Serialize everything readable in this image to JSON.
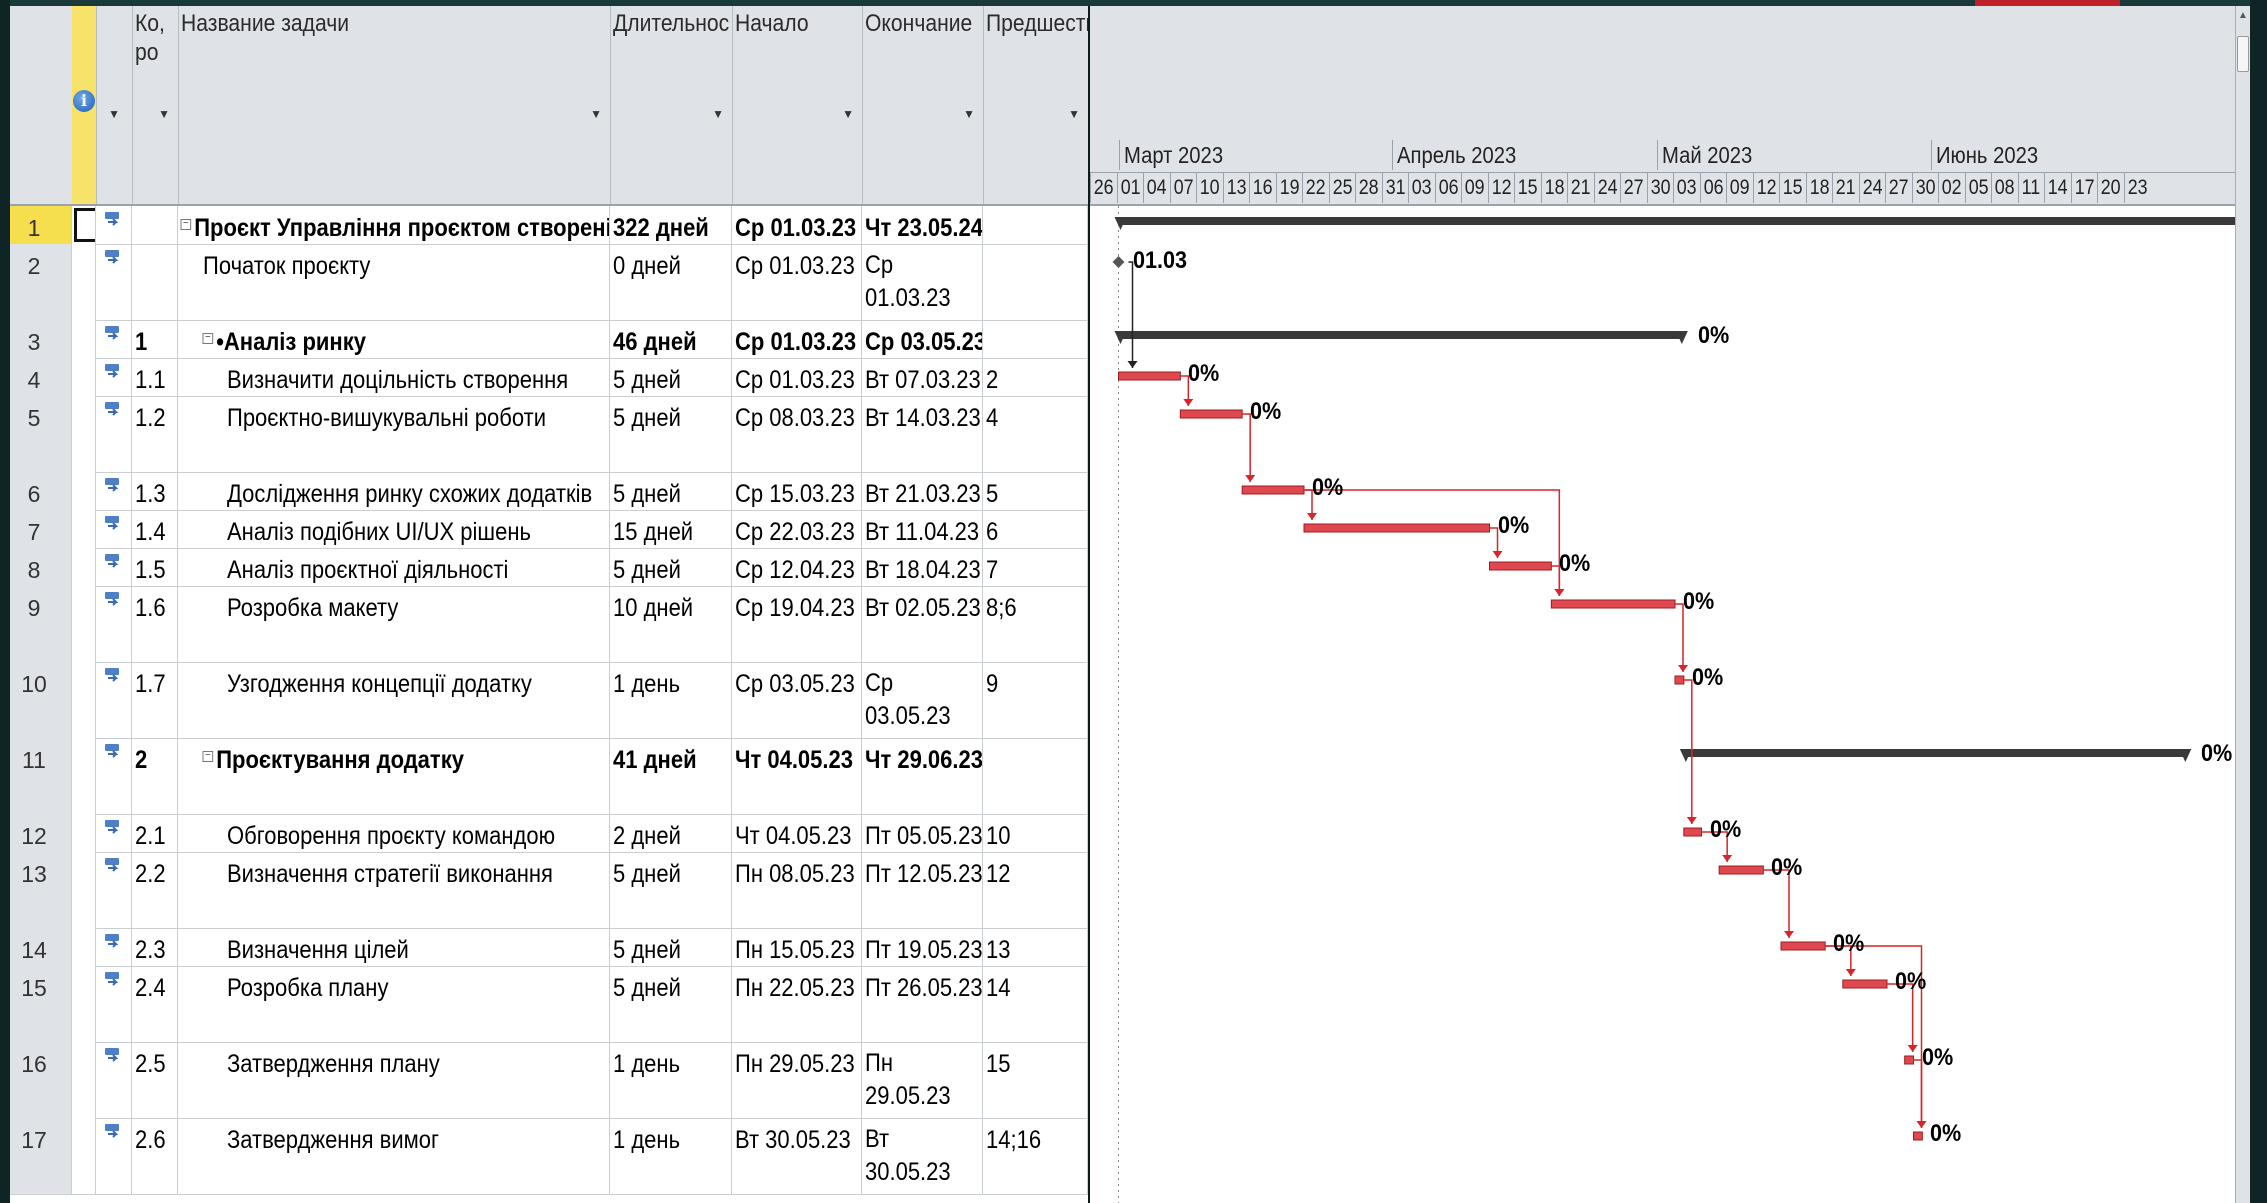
{
  "columns": {
    "info": "",
    "code": "Ко, ро",
    "name": "Название задачи",
    "duration": "Длительнос",
    "start": "Начало",
    "finish": "Окончание",
    "predecessors": "Предшеств"
  },
  "timescale": {
    "months": [
      "Март 2023",
      "Апрель 2023",
      "Май 2023",
      "Июнь 2023"
    ],
    "days": [
      "26",
      "01",
      "04",
      "07",
      "10",
      "13",
      "16",
      "19",
      "22",
      "25",
      "28",
      "31",
      "03",
      "06",
      "09",
      "12",
      "15",
      "18",
      "21",
      "24",
      "27",
      "30",
      "03",
      "06",
      "09",
      "12",
      "15",
      "18",
      "21",
      "24",
      "27",
      "30",
      "02",
      "05",
      "08",
      "11",
      "14",
      "17",
      "20",
      "23"
    ]
  },
  "tasks": [
    {
      "id": "1",
      "code": "",
      "name": "Проєкт Управління проєктом створені",
      "duration": "322 дней",
      "start": "Ср 01.03.23",
      "finish": "Чт 23.05.24",
      "pred": "",
      "bold": true,
      "indent": 0,
      "collapse": true
    },
    {
      "id": "2",
      "code": "",
      "name": "Початок проєкту",
      "duration": "0 дней",
      "start": "Ср 01.03.23",
      "finish": "Ср 01.03.23",
      "pred": "",
      "bold": false,
      "indent": 1,
      "collapse": false
    },
    {
      "id": "3",
      "code": "1",
      "name": "•Аналіз ринку",
      "duration": "46 дней",
      "start": "Ср 01.03.23",
      "finish": "Ср 03.05.23",
      "pred": "",
      "bold": true,
      "indent": 1,
      "collapse": true
    },
    {
      "id": "4",
      "code": "1.1",
      "name": "Визначити доцільність створення",
      "duration": "5 дней",
      "start": "Ср 01.03.23",
      "finish": "Вт 07.03.23",
      "pred": "2",
      "bold": false,
      "indent": 2,
      "collapse": false
    },
    {
      "id": "5",
      "code": "1.2",
      "name": "Проєктно-вишукувальні роботи",
      "duration": "5 дней",
      "start": "Ср 08.03.23",
      "finish": "Вт 14.03.23",
      "pred": "4",
      "bold": false,
      "indent": 2,
      "collapse": false
    },
    {
      "id": "6",
      "code": "1.3",
      "name": "Дослідження ринку схожих додатків",
      "duration": "5 дней",
      "start": "Ср 15.03.23",
      "finish": "Вт 21.03.23",
      "pred": "5",
      "bold": false,
      "indent": 2,
      "collapse": false
    },
    {
      "id": "7",
      "code": "1.4",
      "name": "Аналіз подібних UI/UX рішень",
      "duration": "15 дней",
      "start": "Ср 22.03.23",
      "finish": "Вт 11.04.23",
      "pred": "6",
      "bold": false,
      "indent": 2,
      "collapse": false
    },
    {
      "id": "8",
      "code": "1.5",
      "name": "Аналіз проєктної діяльності",
      "duration": "5 дней",
      "start": "Ср 12.04.23",
      "finish": "Вт 18.04.23",
      "pred": "7",
      "bold": false,
      "indent": 2,
      "collapse": false
    },
    {
      "id": "9",
      "code": "1.6",
      "name": "Розробка макету",
      "duration": "10 дней",
      "start": "Ср 19.04.23",
      "finish": "Вт 02.05.23",
      "pred": "8;6",
      "bold": false,
      "indent": 2,
      "collapse": false
    },
    {
      "id": "10",
      "code": "1.7",
      "name": "Узгодження концепції додатку",
      "duration": "1 день",
      "start": "Ср 03.05.23",
      "finish": "Ср 03.05.23",
      "pred": "9",
      "bold": false,
      "indent": 2,
      "collapse": false
    },
    {
      "id": "11",
      "code": "2",
      "name": "Проєктування додатку",
      "duration": "41 дней",
      "start": "Чт 04.05.23",
      "finish": "Чт 29.06.23",
      "pred": "",
      "bold": true,
      "indent": 1,
      "collapse": true
    },
    {
      "id": "12",
      "code": "2.1",
      "name": "Обговорення проєкту командою",
      "duration": "2 дней",
      "start": "Чт 04.05.23",
      "finish": "Пт 05.05.23",
      "pred": "10",
      "bold": false,
      "indent": 2,
      "collapse": false
    },
    {
      "id": "13",
      "code": "2.2",
      "name": "Визначення стратегії виконання",
      "duration": "5 дней",
      "start": "Пн 08.05.23",
      "finish": "Пт 12.05.23",
      "pred": "12",
      "bold": false,
      "indent": 2,
      "collapse": false
    },
    {
      "id": "14",
      "code": "2.3",
      "name": "Визначення цілей",
      "duration": "5 дней",
      "start": "Пн 15.05.23",
      "finish": "Пт 19.05.23",
      "pred": "13",
      "bold": false,
      "indent": 2,
      "collapse": false
    },
    {
      "id": "15",
      "code": "2.4",
      "name": "Розробка  плану",
      "duration": "5 дней",
      "start": "Пн 22.05.23",
      "finish": "Пт 26.05.23",
      "pred": "14",
      "bold": false,
      "indent": 2,
      "collapse": false
    },
    {
      "id": "16",
      "code": "2.5",
      "name": "Затвердження  плану",
      "duration": "1 день",
      "start": "Пн 29.05.23",
      "finish": "Пн 29.05.23",
      "pred": "15",
      "bold": false,
      "indent": 2,
      "collapse": false
    },
    {
      "id": "17",
      "code": "2.6",
      "name": "Затвердження вимог",
      "duration": "1 день",
      "start": "Вт 30.05.23",
      "finish": "Вт 30.05.23",
      "pred": "14;16",
      "bold": false,
      "indent": 2,
      "collapse": false
    }
  ],
  "gantt_labels": {
    "milestone": "01.03",
    "pct": "0%"
  },
  "colors": {
    "task_bar": "#e0484f",
    "summary_bar": "#3a3a3a",
    "link": "#d8242b",
    "header_bg": "#dfe3e8",
    "indicator_col": "#f7e36a"
  }
}
